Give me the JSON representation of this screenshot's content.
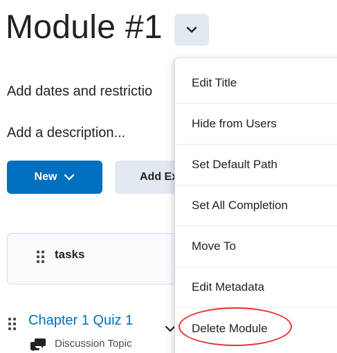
{
  "page": {
    "title": "Module #1",
    "add_dates_text": "Add dates and restrictio",
    "add_description_text": "Add a description...",
    "new_button_label": "New",
    "add_existing_label": "Add Ex"
  },
  "content": {
    "task_card_label": "tasks",
    "quiz_title": "Chapter 1 Quiz 1",
    "quiz_type": "Discussion Topic"
  },
  "menu": {
    "items": [
      "Edit Title",
      "Hide from Users",
      "Set Default Path",
      "Set All Completion",
      "Move To",
      "Edit Metadata",
      "Delete Module"
    ]
  },
  "colors": {
    "primary": "#006fbf",
    "secondary_button": "#e3e9f1",
    "highlight_circle": "#e8302c"
  }
}
